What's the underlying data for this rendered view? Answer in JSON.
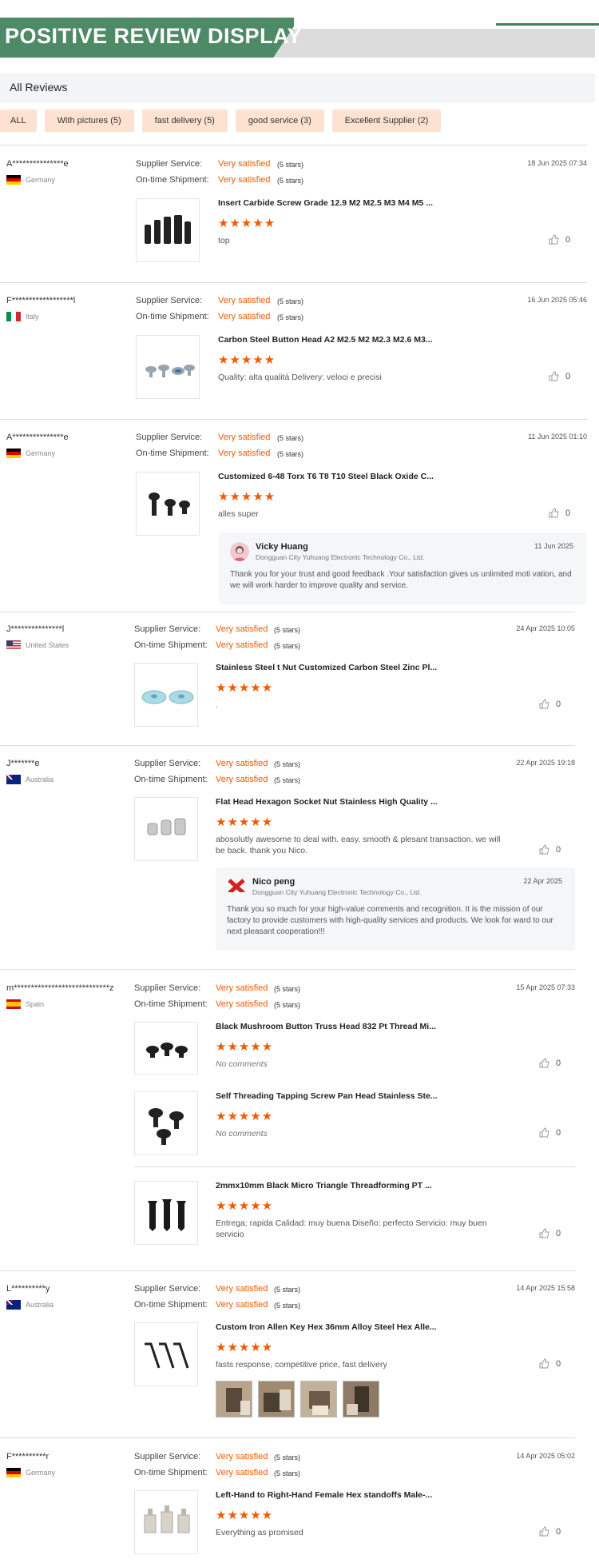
{
  "banner": {
    "title": "POSITIVE REVIEW DISPLAY"
  },
  "all_reviews_label": "All Reviews",
  "filters": [
    "ALL",
    "With pictures (5)",
    "fast delivery (5)",
    "good service (3)",
    "Excellent Supplier (2)"
  ],
  "labels": {
    "supplier_service": "Supplier Service:",
    "ontime_shipment": "On-time Shipment:"
  },
  "rating_value": "Very satisfied",
  "rating_stars": "(5 stars)",
  "stars_glyph": "★★★★★",
  "like_count": "0",
  "reviews": [
    {
      "user": "A***************e",
      "country": "Germany",
      "date": "18 Jun 2025 07:34",
      "products": [
        {
          "name": "Insert Carbide Screw Grade 12.9 M2 M2.5 M3 M4 M5 ...",
          "comment": "top"
        }
      ]
    },
    {
      "user": "F******************l",
      "country": "Italy",
      "date": "16 Jun 2025 05:46",
      "products": [
        {
          "name": "Carbon Steel Button Head A2 M2.5 M2 M2.3 M2.6 M3...",
          "comment": "Quality:   alta qualità Delivery:   veloci e precisi"
        }
      ]
    },
    {
      "user": "A***************e",
      "country": "Germany",
      "date": "11 Jun 2025 01:10",
      "products": [
        {
          "name": "Customized 6-48 Torx T6 T8 T10 Steel Black Oxide C...",
          "comment": "alles super"
        }
      ],
      "reply": {
        "name": "Vicky Huang",
        "company": "Dongguan City Yuhuang Electronic Technology Co., Ltd.",
        "date": "11 Jun 2025",
        "text": "Thank you for your trust and good feedback .Your satisfaction gives us unlimited moti vation, and we will work harder to improve quality and service."
      }
    },
    {
      "user": "J***************l",
      "country": "United States",
      "date": "24 Apr 2025 10:05",
      "products": [
        {
          "name": "Stainless Steel t Nut Customized Carbon Steel Zinc Pl...",
          "comment": "."
        }
      ]
    },
    {
      "user": "J*******e",
      "country": "Australia",
      "date": "22 Apr 2025 19:18",
      "products": [
        {
          "name": "Flat Head Hexagon Socket Nut Stainless High Quality ...",
          "comment": "abosolutly awesome to deal with. easy, smooth & plesant transaction. we will be back. thank you Nico."
        }
      ],
      "reply": {
        "name": "Nico peng",
        "company": "Dongguan City Yuhuang Electronic Technology Co., Ltd.",
        "date": "22 Apr 2025",
        "text": "Thank you so much for your high-value comments and recognition. It is the mission of our factory to provide customers with high-quality services and products. We look for ward to our next pleasant cooperation!!!"
      }
    },
    {
      "user": "m****************************z",
      "country": "Spain",
      "date": "15 Apr 2025 07:33",
      "products": [
        {
          "name": "Black Mushroom Button Truss Head 832 Pt Thread Mi...",
          "comment": "No comments"
        },
        {
          "name": "Self Threading Tapping Screw Pan Head Stainless Ste...",
          "comment": "No comments"
        },
        {
          "name": "2mmx10mm Black Micro Triangle Threadforming PT ...",
          "comment": "Entrega:  rapida  Calidad:   muy buena Diseño:   perfecto Servicio:   muy buen servicio"
        }
      ]
    },
    {
      "user": "L**********y",
      "country": "Australia",
      "date": "14 Apr 2025 15:58",
      "products": [
        {
          "name": "Custom Iron Allen Key Hex 36mm Alloy Steel Hex Alle...",
          "comment": "fasts response, competitive price, fast delivery"
        }
      ]
    },
    {
      "user": "F**********r",
      "country": "Germany",
      "date": "14 Apr 2025 05:02",
      "products": [
        {
          "name": "Left-Hand to Right-Hand Female Hex standoffs Male-...",
          "comment": "Everything as promised"
        }
      ]
    }
  ]
}
